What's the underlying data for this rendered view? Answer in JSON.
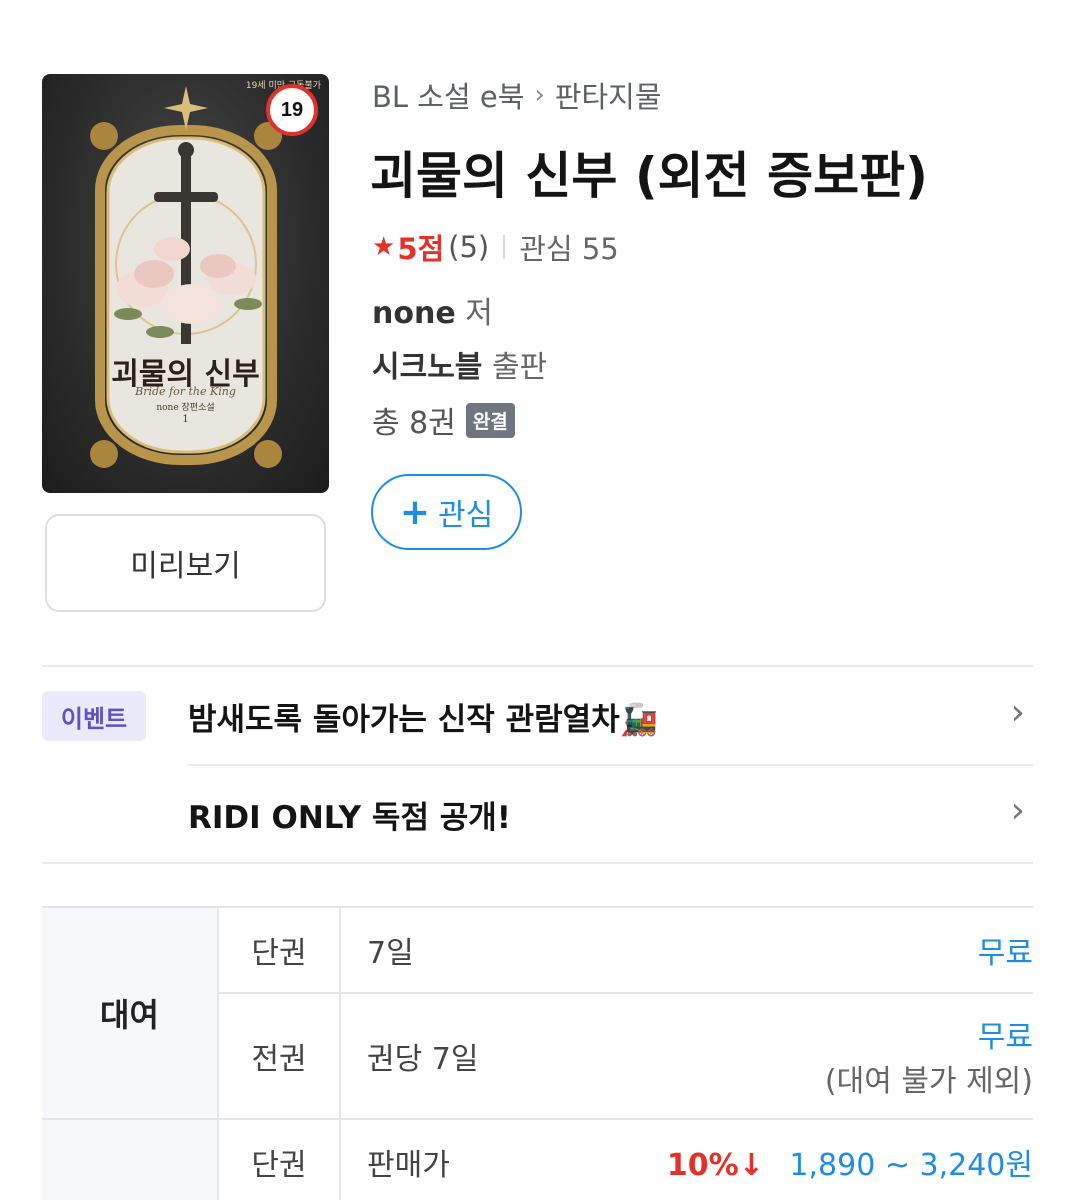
{
  "cover": {
    "age_rating": "19",
    "top_label": "19세 미만 구독불가",
    "title": "괴물의 신부",
    "subtitle": "Bride for the King",
    "author": "none 장편소설",
    "volume": "1"
  },
  "preview_button": "미리보기",
  "breadcrumb": {
    "category": "BL 소설 e북",
    "separator": "›",
    "subcategory": "판타지물"
  },
  "title": "괴물의 신부 (외전 증보판)",
  "rating": {
    "star": "★",
    "score": "5점",
    "count": "(5)",
    "interest": "관심 55"
  },
  "author": {
    "name": "none",
    "role": "저"
  },
  "publisher": {
    "name": "시크노블",
    "role": "출판"
  },
  "volumes": {
    "text": "총 8권",
    "badge": "완결"
  },
  "wish_button": {
    "icon": "+",
    "label": "관심"
  },
  "events": {
    "tag": "이벤트",
    "items": [
      "밤새도록 돌아가는 신작 관람열차🚂",
      "RIDI ONLY 독점 공개!"
    ],
    "chevron": "›"
  },
  "price_table": {
    "rent": {
      "label": "대여",
      "rows": [
        {
          "type": "단권",
          "period": "7일",
          "price": "무료"
        },
        {
          "type": "전권",
          "period": "권당 7일",
          "price": "무료",
          "note": "(대여 불가 제외)"
        }
      ]
    },
    "buy": {
      "rows": [
        {
          "type": "단권",
          "period": "판매가",
          "discount": "10%↓",
          "price": "1,890 ~ 3,240원"
        }
      ]
    }
  },
  "colors": {
    "accent_blue": "#1f8ce6",
    "accent_red": "#e6312b",
    "event_purple": "#5b53c6"
  }
}
